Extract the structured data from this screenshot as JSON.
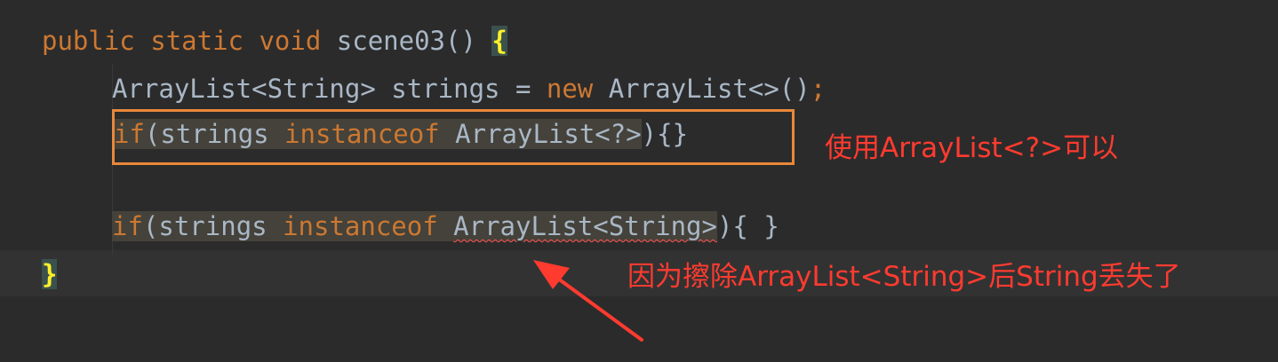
{
  "code": {
    "line1": {
      "kw_public": "public",
      "kw_static": "static",
      "kw_void": "void",
      "method": "scene03",
      "parens": "()",
      "open_brace": "{"
    },
    "line2": {
      "decl": "ArrayList<String> strings = ",
      "kw_new": "new",
      "ctor": " ArrayList<>()",
      "semicolon": ";"
    },
    "line3": {
      "kw_if": "if",
      "open": "(",
      "var": "strings",
      "kw_instanceof": "instanceof",
      "type": "ArrayList<?>",
      "close": "){}"
    },
    "line4": {
      "kw_if": "if",
      "open": "(",
      "var": "strings",
      "kw_instanceof": "instanceof",
      "type_base": "ArrayList<String>",
      "close": "){ }"
    },
    "line5": {
      "close_brace": "}"
    }
  },
  "annotations": {
    "note_ok": "使用ArrayList<?>可以",
    "note_error": "因为擦除ArrayList<String>后String丢失了"
  },
  "colors": {
    "background": "#2b2b2b",
    "keyword": "#cc7832",
    "text": "#a9b7c6",
    "brace_match": "#ffef28",
    "annotation": "#ff3b30",
    "highlight_box": "#e8883a"
  }
}
